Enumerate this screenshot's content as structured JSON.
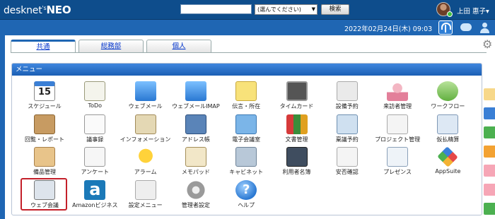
{
  "header": {
    "logo_prefix": "desknet",
    "logo_apos": "'s",
    "logo_suffix": "NEO",
    "search_select": "(選んでください)",
    "search_button": "検索",
    "user_name": "上田 惠子▾"
  },
  "datebar": {
    "date": "2022年02月24日(木) 09:03"
  },
  "tabs": [
    {
      "label": "共通",
      "active": true
    },
    {
      "label": "総務部",
      "active": false
    },
    {
      "label": "個人",
      "active": false
    }
  ],
  "menu": {
    "title": "メニュー",
    "items": [
      {
        "label": "スケジュール",
        "icon": "calendar-icon",
        "day": "15"
      },
      {
        "label": "ToDo",
        "icon": "todo-icon"
      },
      {
        "label": "ウェブメール",
        "icon": "webmail-icon"
      },
      {
        "label": "ウェブメールIMAP",
        "icon": "webmail-imap-icon"
      },
      {
        "label": "伝言・所在",
        "icon": "memo-icon"
      },
      {
        "label": "タイムカード",
        "icon": "timecard-icon"
      },
      {
        "label": "設備予約",
        "icon": "facility-icon"
      },
      {
        "label": "来訪者管理",
        "icon": "visitor-icon"
      },
      {
        "label": "ワークフロー",
        "icon": "workflow-icon"
      },
      {
        "label": "回覧・レポート",
        "icon": "circular-icon"
      },
      {
        "label": "議事録",
        "icon": "minutes-icon"
      },
      {
        "label": "インフォメーション",
        "icon": "information-icon"
      },
      {
        "label": "アドレス帳",
        "icon": "address-book-icon"
      },
      {
        "label": "電子会議室",
        "icon": "forum-icon"
      },
      {
        "label": "文書管理",
        "icon": "documents-icon"
      },
      {
        "label": "稟議予約",
        "icon": "purchase-icon"
      },
      {
        "label": "プロジェクト管理",
        "icon": "project-icon"
      },
      {
        "label": "仮払精算",
        "icon": "expense-icon"
      },
      {
        "label": "備品管理",
        "icon": "equipment-icon"
      },
      {
        "label": "アンケート",
        "icon": "survey-icon"
      },
      {
        "label": "アラーム",
        "icon": "alarm-icon"
      },
      {
        "label": "メモパッド",
        "icon": "memopad-icon"
      },
      {
        "label": "キャビネット",
        "icon": "cabinet-icon"
      },
      {
        "label": "利用者名簿",
        "icon": "directory-icon"
      },
      {
        "label": "安否確認",
        "icon": "safety-icon"
      },
      {
        "label": "プレゼンス",
        "icon": "presence-icon"
      },
      {
        "label": "AppSuite",
        "icon": "appsuite-icon"
      },
      {
        "label": "ウェブ会議",
        "icon": "web-conference-icon"
      },
      {
        "label": "Amazonビジネス",
        "icon": "amazon-icon",
        "glyph": "a"
      },
      {
        "label": "設定メニュー",
        "icon": "settings-menu-icon"
      },
      {
        "label": "管理者設定",
        "icon": "admin-settings-icon"
      },
      {
        "label": "ヘルプ",
        "icon": "help-icon",
        "glyph": "?"
      }
    ]
  },
  "colors": {
    "header_bg": "#0e4d8c",
    "datebar_bg": "#1f66b3",
    "menu_header": "#2a72cc",
    "highlight": "#c4202a"
  }
}
